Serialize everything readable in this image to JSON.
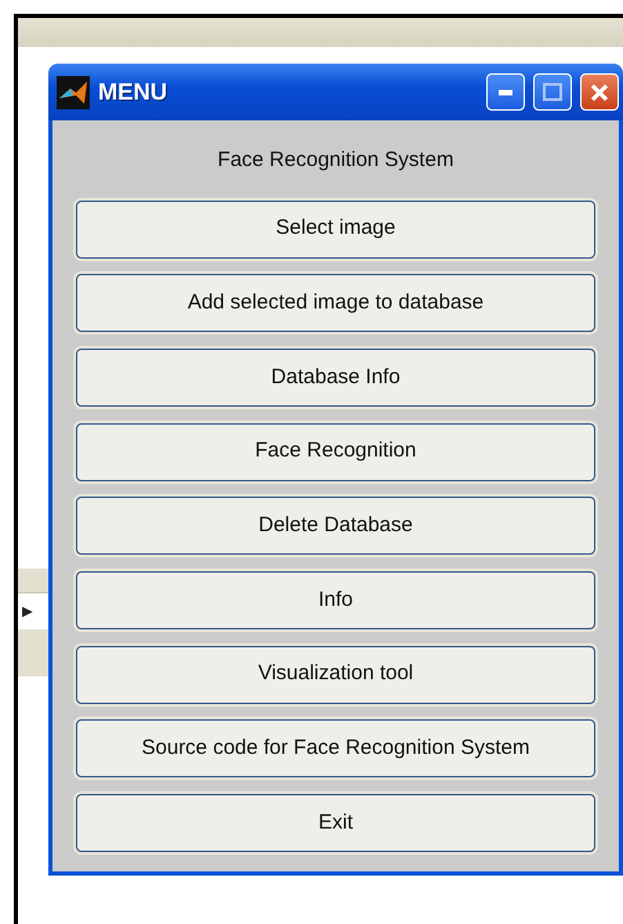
{
  "window": {
    "title": "MENU"
  },
  "heading": "Face Recognition System",
  "buttons": [
    "Select image",
    "Add selected image to database",
    "Database Info",
    "Face Recognition",
    "Delete Database",
    "Info",
    "Visualization tool",
    "Source code for Face Recognition System",
    "Exit"
  ],
  "background_window": {
    "row_marker": "▶"
  }
}
